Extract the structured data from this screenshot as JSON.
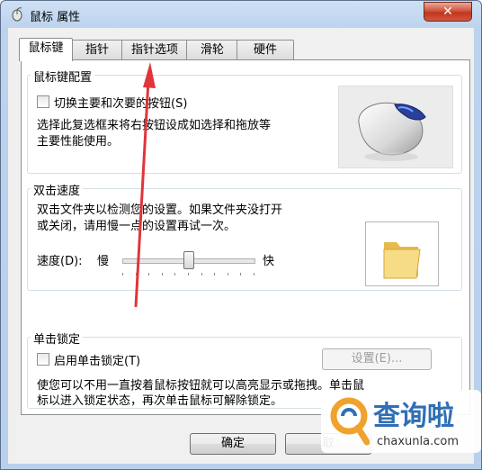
{
  "window": {
    "title": "鼠标 属性",
    "close_label": "✕"
  },
  "tabs": [
    {
      "label": "鼠标键"
    },
    {
      "label": "指针"
    },
    {
      "label": "指针选项"
    },
    {
      "label": "滑轮"
    },
    {
      "label": "硬件"
    }
  ],
  "button_config": {
    "title": "鼠标键配置",
    "swap_label": "切换主要和次要的按钮(S)",
    "swap_checked": false,
    "description_line1": "选择此复选框来将右按钮设成如选择和拖放等",
    "description_line2": "主要性能使用。"
  },
  "double_click": {
    "title": "双击速度",
    "description_line1": "双击文件夹以检测您的设置。如果文件夹没打开",
    "description_line2": "或关闭，请用慢一点的设置再试一次。",
    "speed_label": "速度(D):",
    "slow_label": "慢",
    "fast_label": "快",
    "speed_value": 0.5
  },
  "click_lock": {
    "title": "单击锁定",
    "enable_label": "启用单击锁定(T)",
    "enable_checked": false,
    "settings_label": "设置(E)...",
    "description_line1": "使您可以不用一直按着鼠标按钮就可以高亮显示或拖拽。单击鼠",
    "description_line2": "标以进入锁定状态，再次单击鼠标可解除锁定。"
  },
  "footer": {
    "ok_label": "确定",
    "cancel_label": "取"
  },
  "watermark": {
    "brand": "查询啦",
    "url": "chaxunla.com"
  },
  "colors": {
    "annotation_arrow": "#e0353a",
    "watermark_orange": "#f0a22c",
    "watermark_blue": "#2f6fb4"
  }
}
